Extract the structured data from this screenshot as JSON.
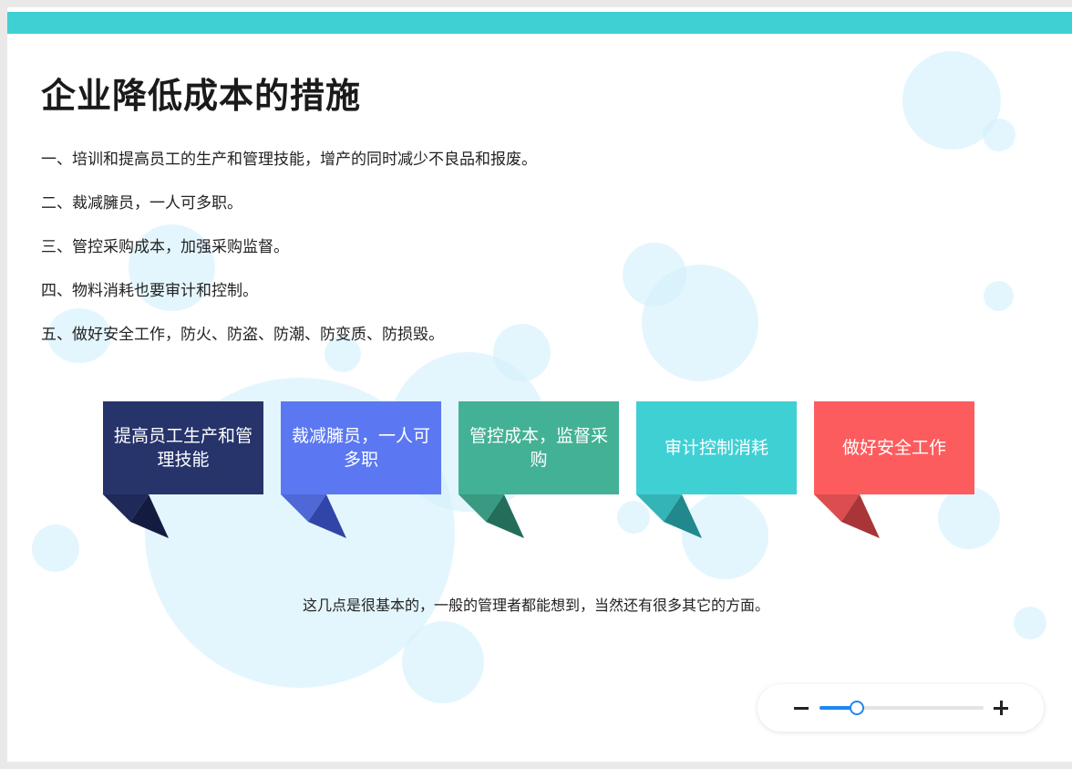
{
  "slide": {
    "title": "企业降低成本的措施",
    "points": [
      "一、培训和提高员工的生产和管理技能，增产的同时减少不良品和报废。",
      "二、裁减臃员，一人可多职。",
      "三、管控采购成本，加强采购监督。",
      "四、物料消耗也要审计和控制。",
      "五、做好安全工作，防火、防盗、防潮、防变质、防损毁。"
    ],
    "cards": [
      {
        "label": "提高员工生产和管理技能",
        "color": "#27346b",
        "fold_light": "#1f2a58",
        "fold_dark": "#131c40"
      },
      {
        "label": "裁减臃员，一人可多职",
        "color": "#5b78f2",
        "fold_light": "#4e68d6",
        "fold_dark": "#3145a8"
      },
      {
        "label": "管控成本，监督采购",
        "color": "#43b195",
        "fold_light": "#399a81",
        "fold_dark": "#236d5a"
      },
      {
        "label": "审计控制消耗",
        "color": "#3fd0d4",
        "fold_light": "#35b4b8",
        "fold_dark": "#21898d"
      },
      {
        "label": "做好安全工作",
        "color": "#fd5c5e",
        "fold_light": "#db4d4f",
        "fold_dark": "#a83537"
      }
    ],
    "footnote": "这几点是很基本的，一般的管理者都能想到，当然还有很多其它的方面。"
  },
  "zoom": {
    "minus_icon": "minus-icon",
    "plus_icon": "plus-icon",
    "level_fraction": 0.23,
    "accent_color": "#1e88f0"
  }
}
